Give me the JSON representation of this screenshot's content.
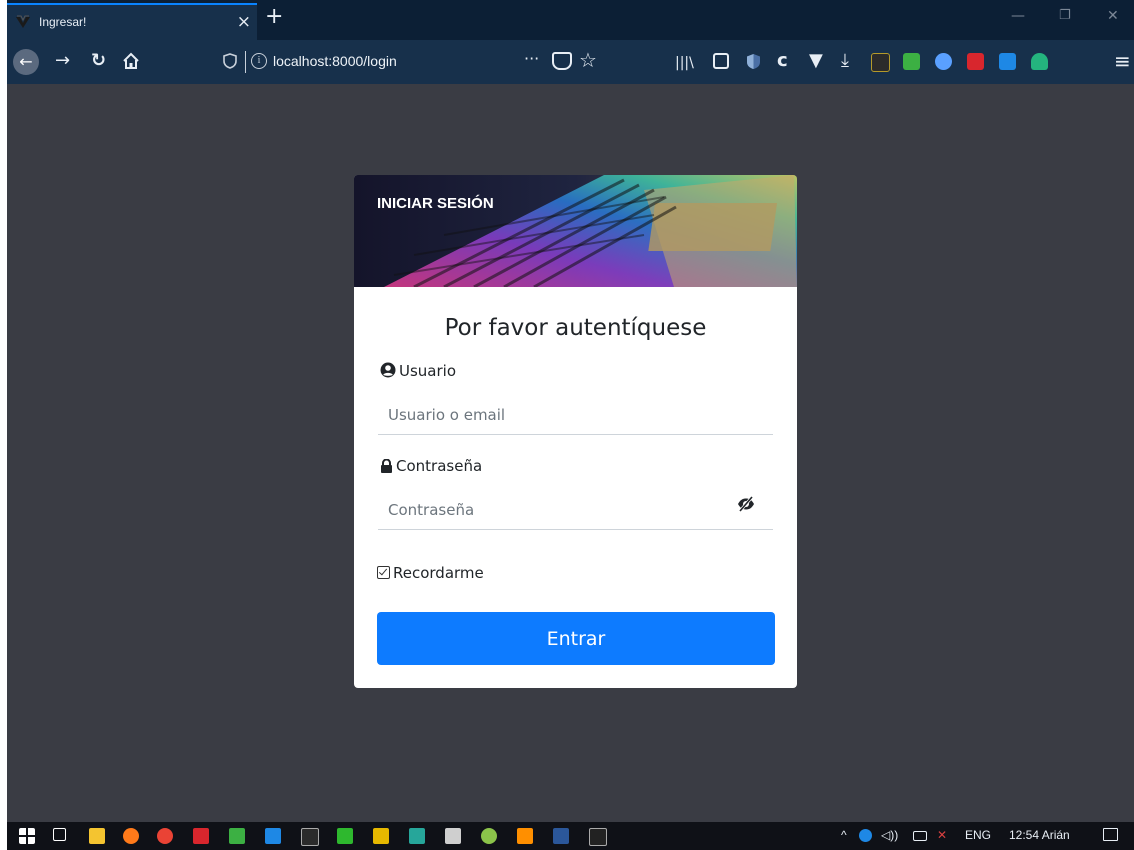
{
  "browser": {
    "tab_title": "Ingresar!",
    "tab_close": "×",
    "new_tab": "+",
    "url": "localhost:8000/login",
    "page_actions": "···",
    "menu": "≡"
  },
  "login": {
    "header_title": "INICIAR SESIÓN",
    "heading": "Por favor autentíquese",
    "username_label": "Usuario",
    "username_placeholder": "Usuario o email",
    "password_label": "Contraseña",
    "password_placeholder": "Contraseña",
    "remember_label": "Recordarme",
    "submit_label": "Entrar",
    "accent": "#0d7bff"
  },
  "taskbar": {
    "language": "ENG",
    "clock": "12:54 Arián"
  }
}
